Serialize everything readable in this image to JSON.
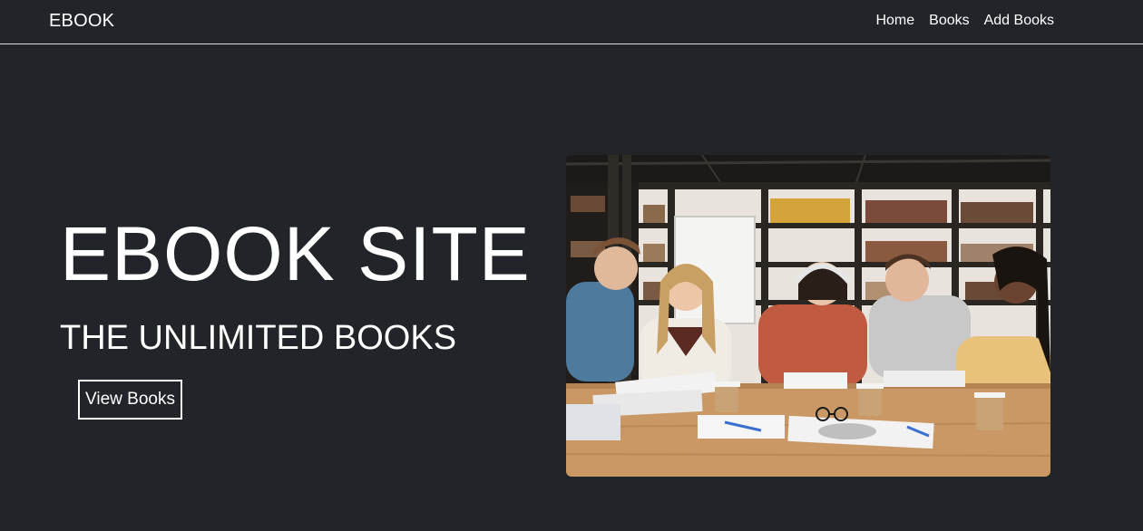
{
  "navbar": {
    "brand": "EBOOK",
    "links": [
      {
        "label": "Home"
      },
      {
        "label": "Books"
      },
      {
        "label": "Add Books"
      }
    ]
  },
  "hero": {
    "title": "EBOOK SITE",
    "subtitle": "THE UNLIMITED BOOKS",
    "button_label": "View Books"
  },
  "colors": {
    "background": "#212529",
    "text": "#ffffff",
    "divider": "#d9dde0"
  }
}
